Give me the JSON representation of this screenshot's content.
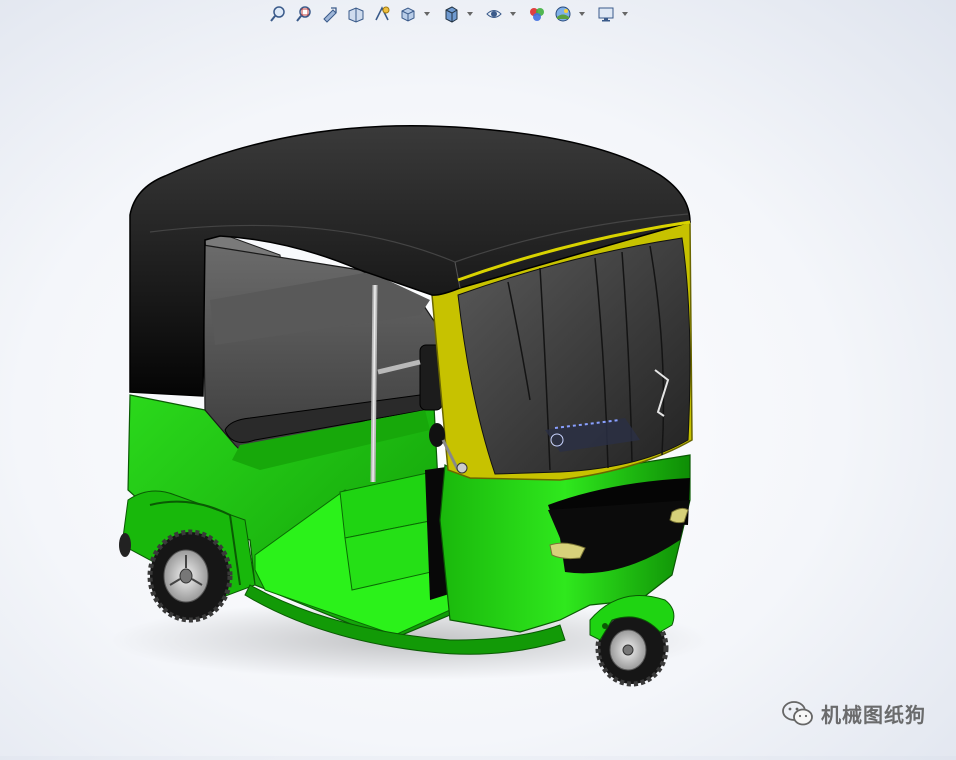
{
  "toolbar": {
    "items": [
      {
        "icon": "zoom-to-fit-icon"
      },
      {
        "icon": "zoom-to-area-icon"
      },
      {
        "icon": "previous-view-icon"
      },
      {
        "icon": "section-view-icon"
      },
      {
        "icon": "dynamic-annotation-icon"
      },
      {
        "icon": "view-orientation-icon",
        "dropdown": true
      },
      {
        "icon": "display-style-icon",
        "dropdown": true
      },
      {
        "icon": "hide-show-items-icon",
        "dropdown": true
      },
      {
        "icon": "edit-appearance-icon"
      },
      {
        "icon": "apply-scene-icon",
        "dropdown": true
      },
      {
        "icon": "view-settings-icon",
        "dropdown": true
      }
    ]
  },
  "model": {
    "subject": "auto-rickshaw-3d-model",
    "colors": {
      "body": "#1fcb12",
      "roof": "#111111",
      "trim": "#c8c200",
      "glass": "#3a3a3a",
      "tyre": "#1a1a1a"
    }
  },
  "watermark": {
    "text": "机械图纸狗"
  }
}
